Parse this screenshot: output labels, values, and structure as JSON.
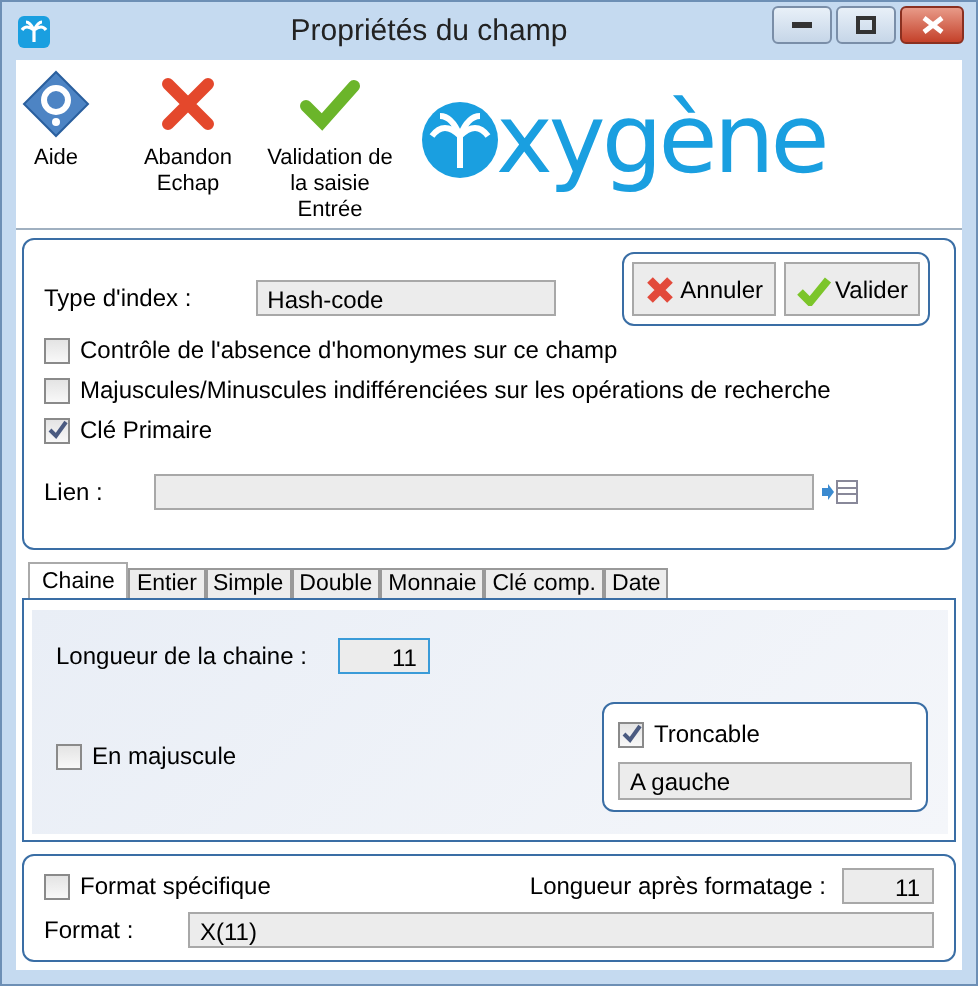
{
  "window": {
    "title": "Propriétés du champ"
  },
  "toolbar": [
    {
      "kind": "help",
      "label": "Aide"
    },
    {
      "kind": "cancel",
      "label": "Abandon\nEchap"
    },
    {
      "kind": "validate",
      "label": "Validation de\nla saisie\nEntrée"
    }
  ],
  "logo": {
    "text": "xygène"
  },
  "index_type": {
    "label": "Type d'index :",
    "value": "Hash-code"
  },
  "actions": [
    {
      "kind": "cancel",
      "label": "Annuler"
    },
    {
      "kind": "validate",
      "label": "Valider"
    }
  ],
  "options": [
    {
      "label": "Contrôle de l'absence d'homonymes sur ce champ",
      "checked": false
    },
    {
      "label": "Majuscules/Minuscules indifférenciées sur les opérations de recherche",
      "checked": false
    },
    {
      "label": "Clé Primaire",
      "checked": true
    }
  ],
  "link": {
    "label": "Lien :"
  },
  "tabs": [
    {
      "label": "Chaine",
      "selected": true
    },
    {
      "label": "Entier",
      "selected": false
    },
    {
      "label": "Simple",
      "selected": false
    },
    {
      "label": "Double",
      "selected": false
    },
    {
      "label": "Monnaie",
      "selected": false
    },
    {
      "label": "Clé comp.",
      "selected": false
    },
    {
      "label": "Date",
      "selected": false
    }
  ],
  "string_tab": {
    "length": {
      "label": "Longueur de la chaine :",
      "value": "11"
    },
    "uppercase": {
      "label": "En majuscule",
      "checked": false
    },
    "truncatable": {
      "label": "Troncable",
      "checked": true,
      "value": "A gauche"
    }
  },
  "format": {
    "specific": {
      "label": "Format spécifique",
      "checked": false
    },
    "length_after": {
      "label": "Longueur après formatage :",
      "value": "11"
    },
    "field": {
      "label": "Format :",
      "value": "X(11)"
    }
  }
}
